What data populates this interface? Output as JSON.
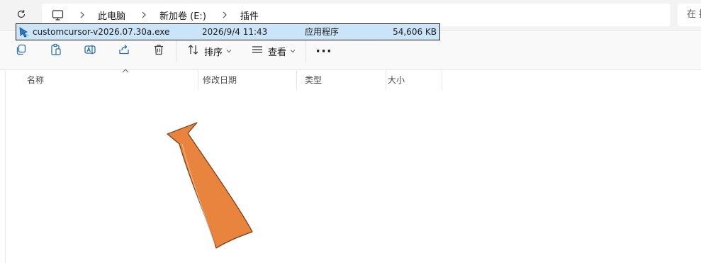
{
  "address_bar": {
    "breadcrumbs": [
      "此电脑",
      "新加卷 (E:)",
      "插件"
    ],
    "search_placeholder": "在 插"
  },
  "toolbar": {
    "sort_label": "排序",
    "view_label": "查看",
    "more_label": "···",
    "icons": [
      "copy-icon",
      "paste-icon",
      "rename-icon",
      "share-icon",
      "delete-icon",
      "sort-icon",
      "view-icon",
      "more-icon"
    ]
  },
  "list": {
    "columns": {
      "name": "名称",
      "modified": "修改日期",
      "type": "类型",
      "size": "大小"
    },
    "files": [
      {
        "name": "customcursor-v2026.07.30a.exe",
        "modified": "2026/9/4 11:43",
        "type": "应用程序",
        "size": "54,606 KB",
        "selected": true
      }
    ]
  },
  "colors": {
    "selection": "#cce4f7",
    "annotation_arrow": "#e8843e",
    "toolbar_bg": "#f9f9f9",
    "address_bg": "#f3f3f3"
  }
}
